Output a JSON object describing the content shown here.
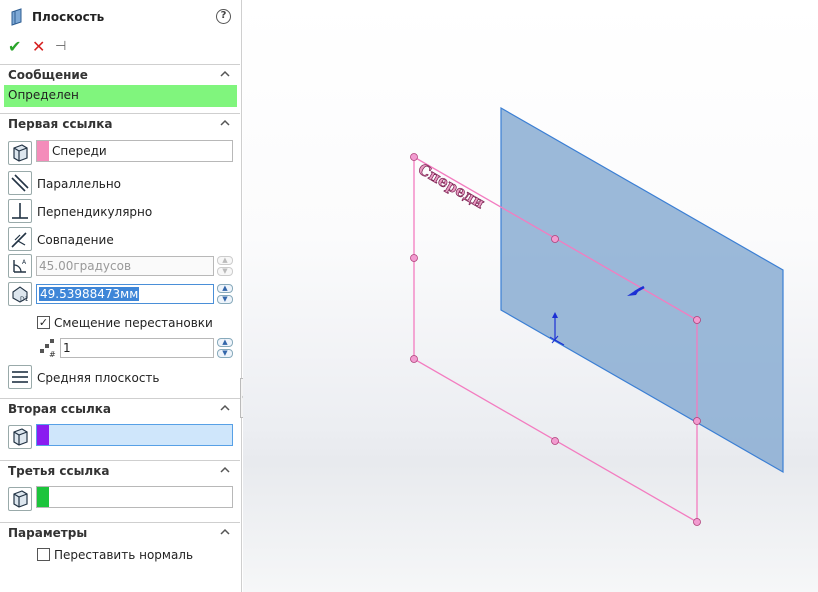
{
  "panel": {
    "title": "Плоскость",
    "help_glyph": "?",
    "actions": {
      "ok": "✔",
      "cancel": "✕",
      "pin": "⊣"
    },
    "message": {
      "header": "Сообщение",
      "text": "Определен"
    },
    "first_ref": {
      "header": "Первая ссылка",
      "value": "Спереди",
      "swatch_color": "#f48cba",
      "options": [
        "Параллельно",
        "Перпендикулярно",
        "Совпадение"
      ],
      "angle_value": "45.00градусов",
      "distance_value": "49.53988473мм",
      "flip_offset_label": "Смещение перестановки",
      "flip_offset_checked": true,
      "instances_value": "1",
      "mid_plane_label": "Средняя плоскость"
    },
    "second_ref": {
      "header": "Вторая ссылка",
      "value": "",
      "swatch_color": "#8a1cf0"
    },
    "third_ref": {
      "header": "Третья ссылка",
      "value": "",
      "swatch_color": "#1cc43c"
    },
    "params": {
      "header": "Параметры",
      "flip_normal_label": "Переставить нормаль",
      "flip_normal_checked": false
    }
  },
  "viewport": {
    "plane_label": "Спереди",
    "plane_color": "#7fa6cf",
    "preview_color": "#f37cc0"
  }
}
